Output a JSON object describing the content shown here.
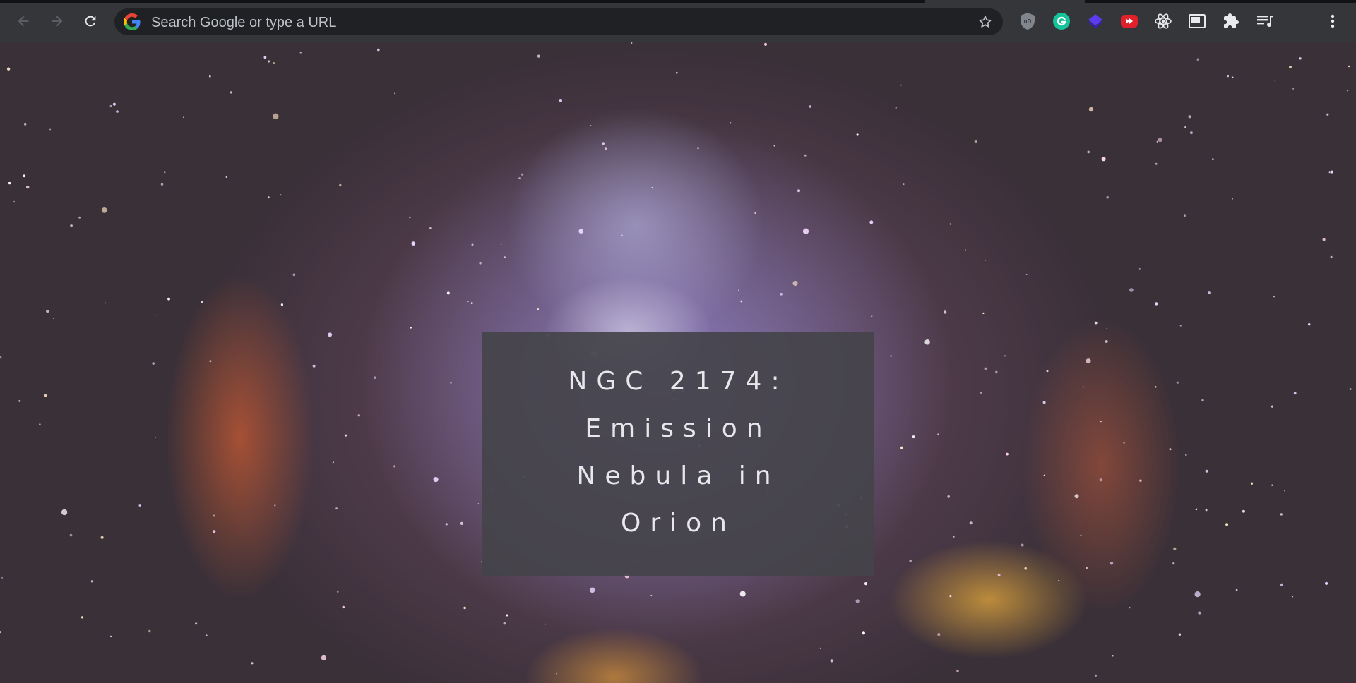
{
  "browser": {
    "omnibox": {
      "placeholder": "Search Google or type a URL",
      "value": ""
    },
    "extensions": [
      "ublock-origin-icon",
      "grammarly-icon",
      "layers-extension-icon",
      "youtube-fast-forward-icon",
      "react-devtools-icon",
      "picture-in-picture-icon",
      "extensions-puzzle-icon",
      "media-controls-icon"
    ],
    "colors": {
      "toolbar": "#35363a",
      "omnibox": "#202124",
      "icon": "#9aa0a6",
      "grammarly": "#15c39a",
      "layers": "#4a2ad8",
      "youtube_ff": "#e0202a"
    }
  },
  "page": {
    "background_image": "emission-nebula-photo",
    "title": "NGC 2174: Emission Nebula in Orion"
  }
}
